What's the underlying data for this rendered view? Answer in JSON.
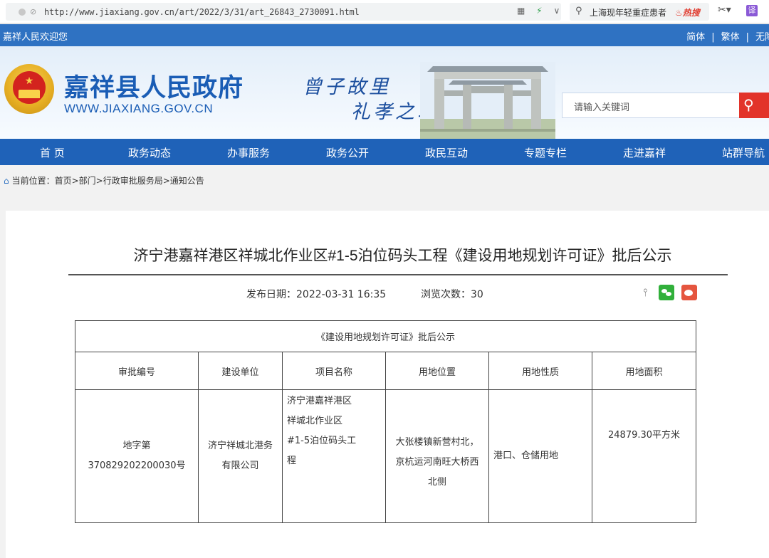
{
  "browser": {
    "url": "http://www.jiaxiang.gov.cn/art/2022/3/31/art_26843_2730091.html",
    "search_query": "上海现年轻重症患者",
    "hot_badge": "热搜",
    "translate_label": "译"
  },
  "topbar": {
    "welcome": "嘉祥人民欢迎您",
    "lang_simplified": "简体",
    "lang_traditional": "繁体",
    "accessibility": "无障碍",
    "separator": "|"
  },
  "header": {
    "site_title": "嘉祥县人民政府",
    "site_url": "WWW.JIAXIANG.GOV.CN",
    "slogan_line1": "曾子故里",
    "slogan_line2": "礼孝之城",
    "search_placeholder": "请输入关键词"
  },
  "nav": {
    "items": [
      "首 页",
      "政务动态",
      "办事服务",
      "政务公开",
      "政民互动",
      "专题专栏",
      "走进嘉祥",
      "站群导航"
    ]
  },
  "breadcrumb": {
    "text": "当前位置：首页>部门>行政审批服务局>通知公告"
  },
  "article": {
    "title": "济宁港嘉祥港区祥城北作业区#1-5泊位码头工程《建设用地规划许可证》批后公示",
    "publish_date": "发布日期：2022-03-31 16:35",
    "view_count": "浏览次数：30"
  },
  "permit_table": {
    "caption": "《建设用地规划许可证》批后公示",
    "headers": [
      "审批编号",
      "建设单位",
      "项目名称",
      "用地位置",
      "用地性质",
      "用地面积"
    ],
    "row": {
      "approval_no_line1": "地字第",
      "approval_no_line2": "370829202200030号",
      "unit_line1": "济宁祥城北港务",
      "unit_line2": "有限公司",
      "project_line1": "济宁港嘉祥港区",
      "project_line2": "祥城北作业区",
      "project_line3": "#1-5泊位码头工",
      "project_line4": "程",
      "location_line1": "大张楼镇新营村北，",
      "location_line2": "京杭运河南旺大桥西",
      "location_line3": "北侧",
      "land_use": "港口、仓储用地",
      "area": "24879.30平方米"
    }
  },
  "colors": {
    "brand_blue": "#1f62b8",
    "search_red": "#e2332a",
    "wechat_green": "#31b03b",
    "weibo_red": "#e5553f"
  }
}
